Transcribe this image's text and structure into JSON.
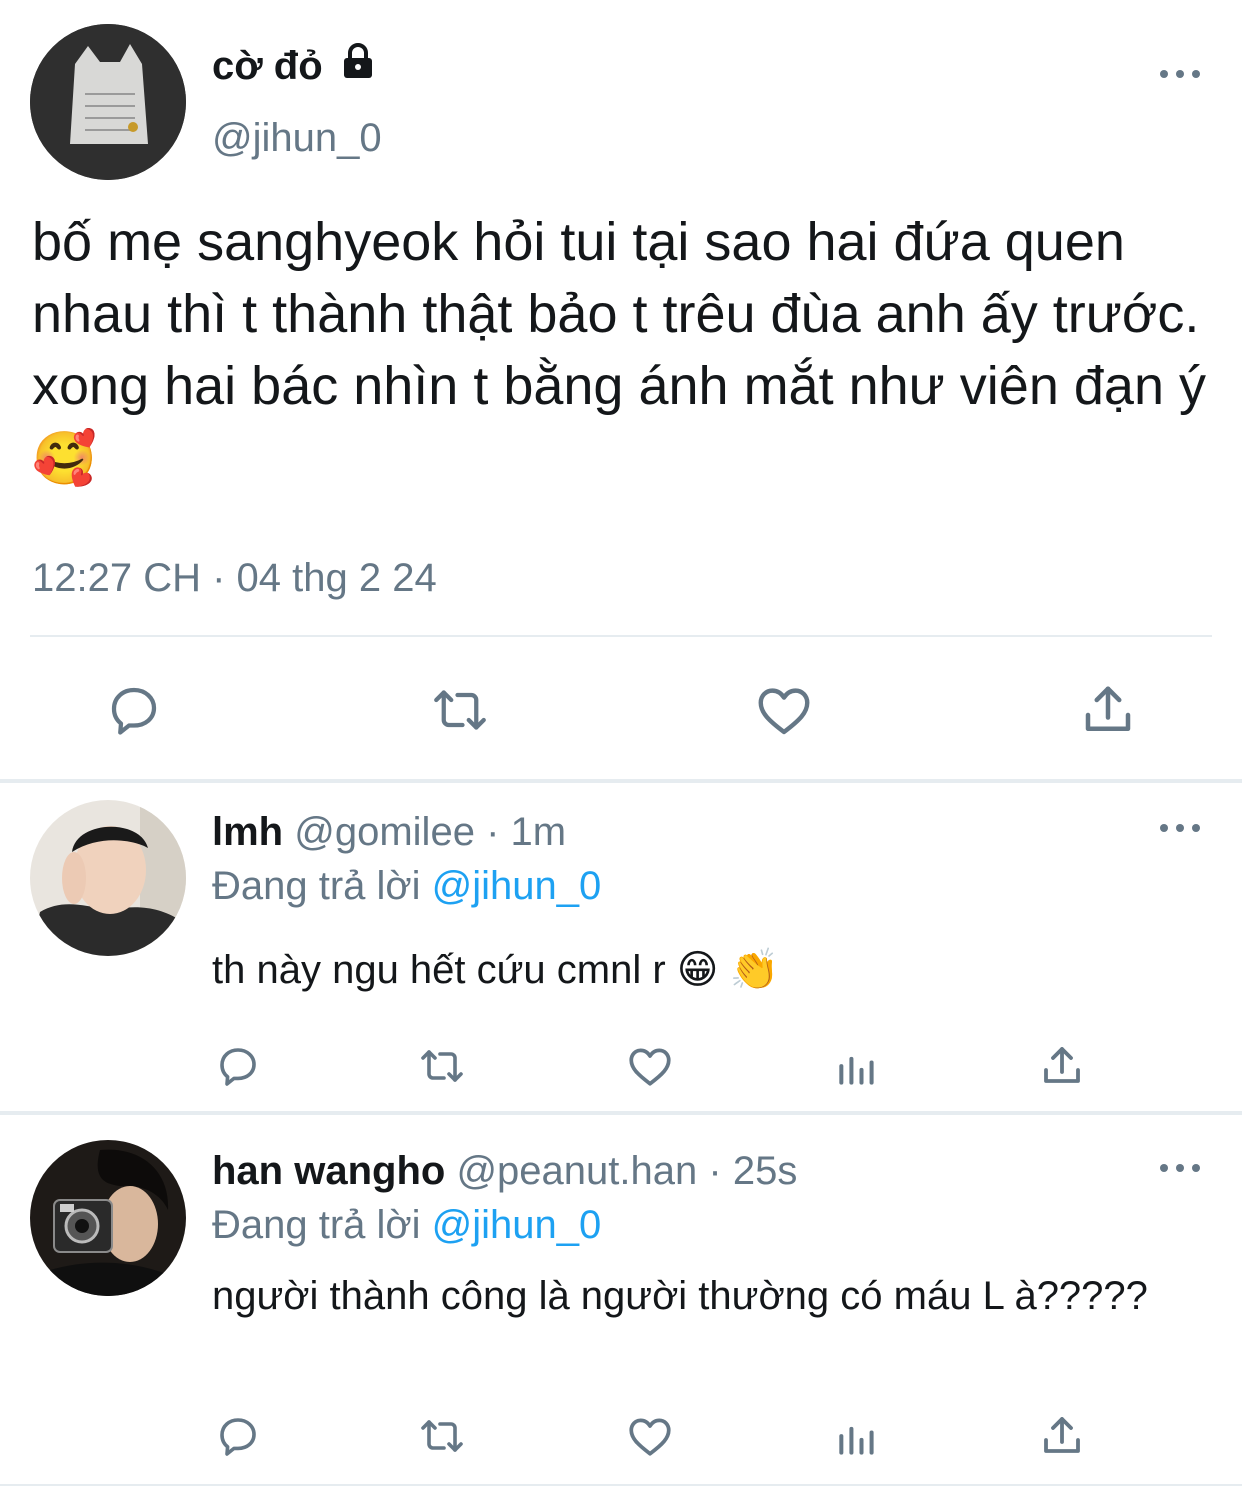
{
  "main_tweet": {
    "display_name": "cờ đỏ",
    "handle": "@jihun_0",
    "text": "bố mẹ sanghyeok hỏi tui tại sao hai đứa quen nhau thì t thành thật bảo t trêu đùa anh ấy trước. xong hai bác nhìn t bằng ánh mắt như viên đạn ý",
    "emoji": "🥰",
    "timestamp": "12:27 CH · 04 thg 2 24",
    "protected_icon": "lock-icon",
    "actions": [
      "reply-icon",
      "retweet-icon",
      "like-icon",
      "share-icon"
    ]
  },
  "replies": [
    {
      "display_name": "lmh",
      "handle": "@gomilee",
      "time": "· 1m",
      "replying_label": "Đang trả lời",
      "replying_to": "@jihun_0",
      "text": "th này ngu hết cứu cmnl r",
      "emoji": "😁 👏",
      "actions": [
        "reply-icon",
        "retweet-icon",
        "like-icon",
        "analytics-icon",
        "share-icon"
      ]
    },
    {
      "display_name": "han wangho",
      "handle": "@peanut.han",
      "time": "· 25s",
      "replying_label": "Đang trả lời",
      "replying_to": "@jihun_0",
      "text": "người thành công là người thường có máu L à?????",
      "actions": [
        "reply-icon",
        "retweet-icon",
        "like-icon",
        "analytics-icon",
        "share-icon"
      ]
    }
  ],
  "colors": {
    "text": "#14171a",
    "secondary": "#657786",
    "link": "#1da1f2",
    "divider": "#e6ecf0"
  }
}
